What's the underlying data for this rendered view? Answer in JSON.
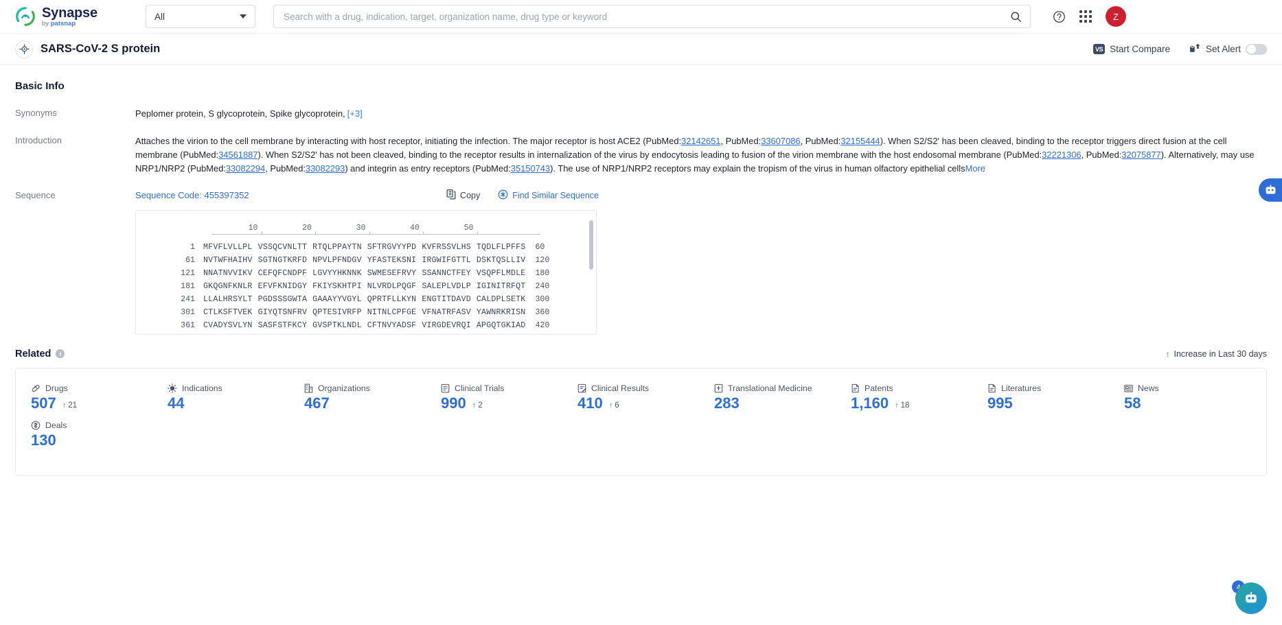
{
  "header": {
    "logo_title": "Synapse",
    "logo_sub_prefix": "by ",
    "logo_sub_brand": "patsnap",
    "scope_value": "All",
    "scope_options": [
      "All"
    ],
    "search_placeholder": "Search with a drug, indication, target, organization name, drug type or keyword",
    "search_value": "",
    "help_icon": "question-circle-icon",
    "apps_icon": "grid-apps-icon",
    "avatar_initial": "Z",
    "avatar_color": "#cc1f2f"
  },
  "titlebar": {
    "entity_icon": "target-crosshair-icon",
    "title": "SARS-CoV-2 S protein",
    "start_compare_label": "Start Compare",
    "start_compare_badge": "VS",
    "set_alert_label": "Set Alert",
    "set_alert_icon": "envelope-alert-icon",
    "set_alert_on": false
  },
  "basic_info": {
    "heading": "Basic Info",
    "synonyms_label": "Synonyms",
    "synonyms_value": "Peplomer protein,  S glycoprotein,  Spike glycoprotein,",
    "synonyms_more": "[+3]",
    "introduction_label": "Introduction",
    "introduction_more": "More",
    "introduction_parts": [
      {
        "t": "Attaches the virion to the cell membrane by interacting with host receptor, initiating the infection. The major receptor is host ACE2 (PubMed:"
      },
      {
        "t": "32142651",
        "link": true
      },
      {
        "t": ", PubMed:"
      },
      {
        "t": "33607086",
        "link": true
      },
      {
        "t": ", PubMed:"
      },
      {
        "t": "32155444",
        "link": true
      },
      {
        "t": "). When S2/S2' has been cleaved, binding to the receptor triggers direct fusion at the cell membrane (PubMed:"
      },
      {
        "t": "34561887",
        "link": true
      },
      {
        "t": "). When S2/S2' has not been cleaved, binding to the receptor results in internalization of the virus by endocytosis leading to fusion of the virion membrane with the host endosomal membrane (PubMed:"
      },
      {
        "t": "32221306",
        "link": true
      },
      {
        "t": ", PubMed:"
      },
      {
        "t": "32075877",
        "link": true
      },
      {
        "t": "). Alternatively, may use NRP1/NRP2 (PubMed:"
      },
      {
        "t": "33082294",
        "link": true
      },
      {
        "t": ", PubMed:"
      },
      {
        "t": "33082293",
        "link": true
      },
      {
        "t": ") and integrin as entry receptors (PubMed:"
      },
      {
        "t": "35150743",
        "link": true
      },
      {
        "t": "). The use of NRP1/NRP2 receptors may explain the tropism of the virus in human olfactory epithelial cells"
      }
    ]
  },
  "sequence": {
    "label": "Sequence",
    "code_label": "Sequence Code: 455397352",
    "copy_label": "Copy",
    "copy_icon": "copy-icon",
    "find_label": "Find Similar Sequence",
    "find_icon": "find-similar-icon",
    "ruler_ticks": [
      10,
      20,
      30,
      40,
      50
    ],
    "lines": [
      {
        "start": "1",
        "blocks": [
          "MFVFLVLLPL",
          "VSSQCVNLTT",
          "RTQLPPAYTN",
          "SFTRGVYYPD",
          "KVFRSSVLHS",
          "TQDLFLPFFS"
        ],
        "end": "60"
      },
      {
        "start": "61",
        "blocks": [
          "NVTWFHAIHV",
          "SGTNGTKRFD",
          "NPVLPFNDGV",
          "YFASTEKSNI",
          "IRGWIFGTTL",
          "DSKTQSLLIV"
        ],
        "end": "120"
      },
      {
        "start": "121",
        "blocks": [
          "NNATNVVIKV",
          "CEFQFCNDPF",
          "LGVYYHKNNK",
          "SWMESEFRVY",
          "SSANNCTFEY",
          "VSQPFLMDLE"
        ],
        "end": "180"
      },
      {
        "start": "181",
        "blocks": [
          "GKQGNFKNLR",
          "EFVFKNIDGY",
          "FKIYSKHTPI",
          "NLVRDLPQGF",
          "SALEPLVDLP",
          "IGINITRFQT"
        ],
        "end": "240"
      },
      {
        "start": "241",
        "blocks": [
          "LLALHRSYLT",
          "PGDSSSGWTA",
          "GAAAYYVGYL",
          "QPRTFLLKYN",
          "ENGTITDAVD",
          "CALDPLSETK"
        ],
        "end": "300"
      },
      {
        "start": "301",
        "blocks": [
          "CTLKSFTVEK",
          "GIYQTSNFRV",
          "QPTESIVRFP",
          "NITNLCPFGE",
          "VFNATRFASV",
          "YAWNRKRISN"
        ],
        "end": "360"
      },
      {
        "start": "361",
        "blocks": [
          "CVADYSVLYN",
          "SASFSTFKCY",
          "GVSPTKLNDL",
          "CFTNVYADSF",
          "VIRGDEVRQI",
          "APGQTGKIAD"
        ],
        "end": "420"
      }
    ]
  },
  "related": {
    "title": "Related",
    "info_icon": "info-icon",
    "increase_note": "Increase in Last 30 days",
    "stats": [
      {
        "label": "Drugs",
        "icon": "capsule-icon",
        "value": "507",
        "delta": "21"
      },
      {
        "label": "Indications",
        "icon": "virus-icon",
        "value": "44",
        "delta": ""
      },
      {
        "label": "Organizations",
        "icon": "building-icon",
        "value": "467",
        "delta": ""
      },
      {
        "label": "Clinical Trials",
        "icon": "clipboard-icon",
        "value": "990",
        "delta": "2"
      },
      {
        "label": "Clinical Results",
        "icon": "results-icon",
        "value": "410",
        "delta": "6"
      },
      {
        "label": "Translational Medicine",
        "icon": "microscope-icon",
        "value": "283",
        "delta": ""
      },
      {
        "label": "Patents",
        "icon": "patent-icon",
        "value": "1,160",
        "delta": "18"
      },
      {
        "label": "Literatures",
        "icon": "book-icon",
        "value": "995",
        "delta": ""
      },
      {
        "label": "News",
        "icon": "news-icon",
        "value": "58",
        "delta": ""
      },
      {
        "label": "Deals",
        "icon": "deal-icon",
        "value": "130",
        "delta": ""
      }
    ]
  },
  "floating": {
    "side_icon": "chat-assistant-icon",
    "bottom_icon": "ai-assistant-icon",
    "badge_count": "4"
  }
}
